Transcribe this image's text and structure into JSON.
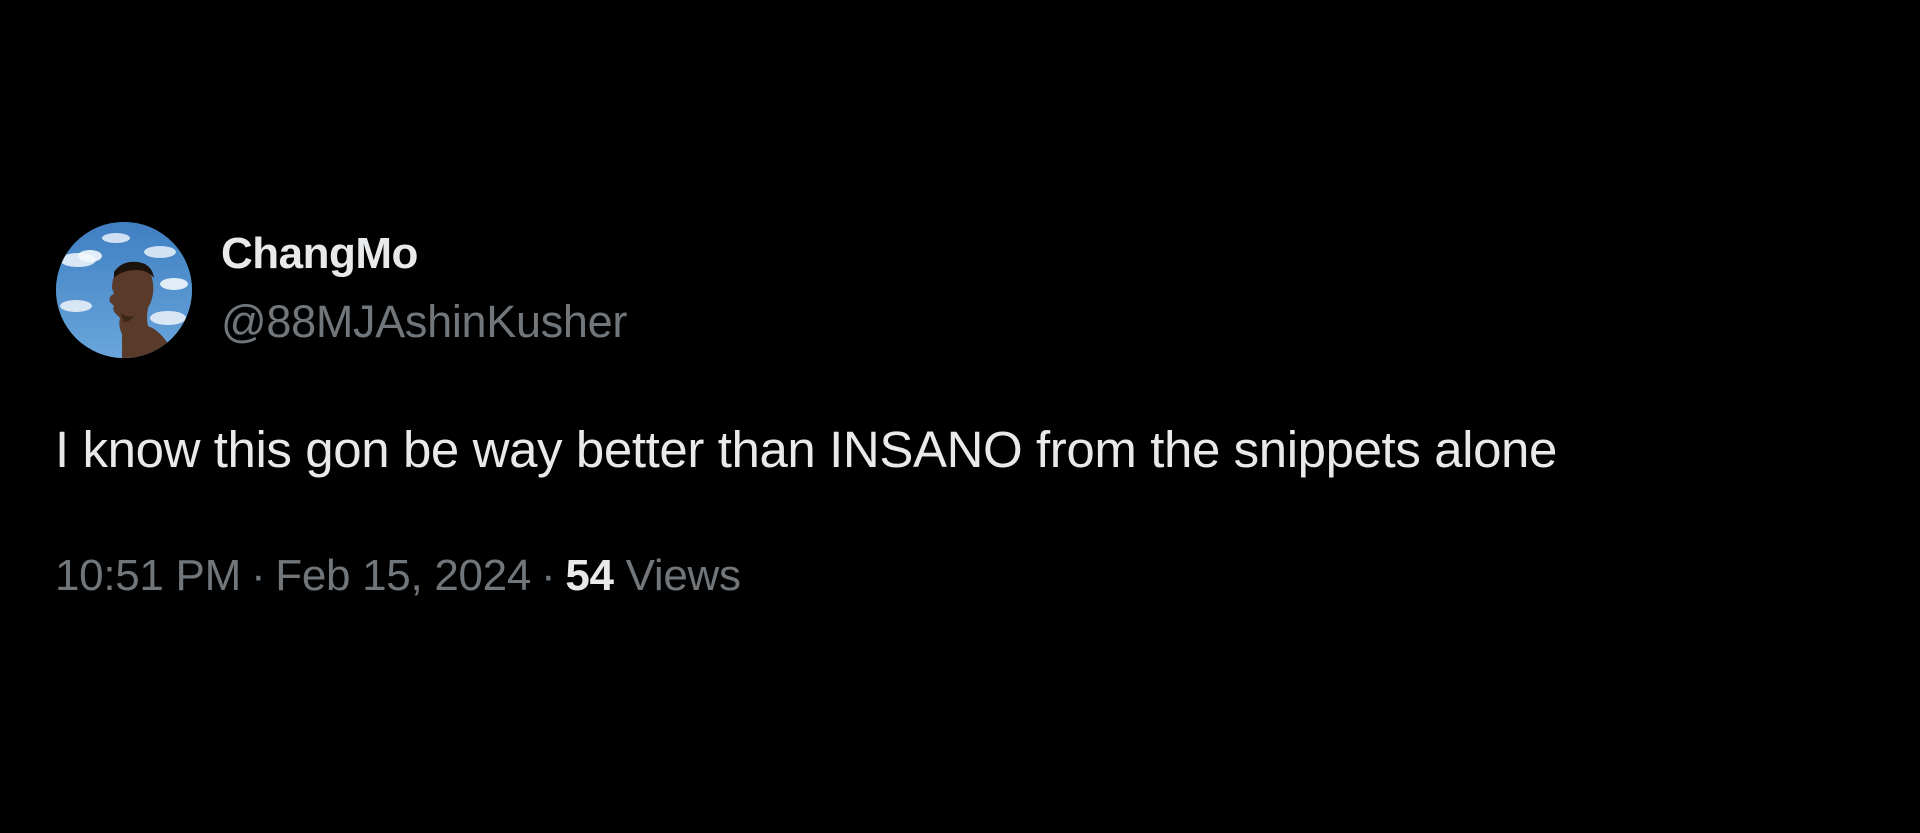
{
  "author": {
    "display_name": "ChangMo",
    "handle": "@88MJAshinKusher",
    "avatar_icon": "profile-avatar-portrait"
  },
  "tweet": {
    "text": "I know this gon be way better than INSANO from the snippets alone"
  },
  "meta": {
    "time": "10:51 PM",
    "separator": "·",
    "date": "Feb 15, 2024",
    "views_count": "54",
    "views_label": "Views"
  },
  "colors": {
    "background": "#000000",
    "primary_text": "#e7e9ea",
    "secondary_text": "#71767b"
  }
}
